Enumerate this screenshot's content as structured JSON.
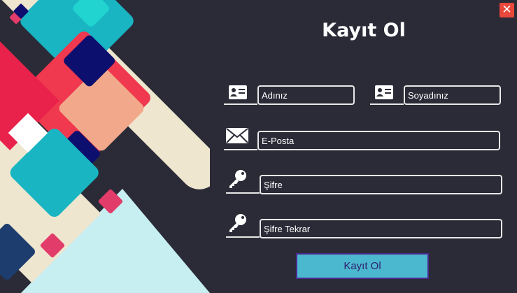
{
  "window": {
    "title": "Kayıt Ol",
    "close_label": "✕"
  },
  "form": {
    "first_name_placeholder": "Adınız",
    "last_name_placeholder": "Soyadınız",
    "email_placeholder": "E-Posta",
    "password_placeholder": "Şifre",
    "password_confirm_placeholder": "Şifre Tekrar",
    "submit_label": "Kayıt Ol"
  },
  "icons": {
    "first_name": "id-card-icon",
    "last_name": "id-card-icon",
    "email": "envelope-icon",
    "password": "key-icon",
    "password_confirm": "key-icon"
  },
  "colors": {
    "background": "#2a2b37",
    "close": "#e8473b",
    "button": "#4cb8cf",
    "button_border": "#4b2a8e"
  }
}
